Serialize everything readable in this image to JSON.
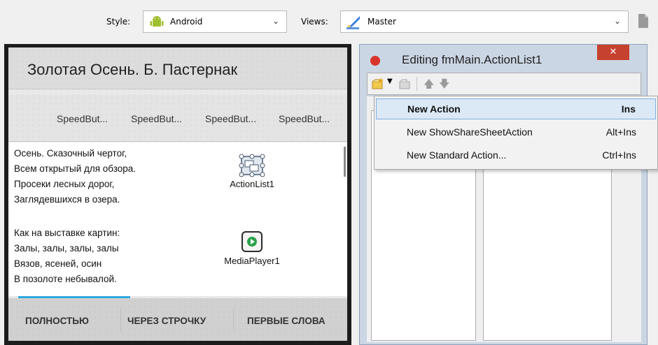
{
  "toolbar": {
    "style_label": "Style:",
    "style_value": "Android",
    "views_label": "Views:",
    "views_value": "Master",
    "style_icon": "android-icon",
    "views_icon": "pencil-ruler-icon"
  },
  "form": {
    "title": "Золотая Осень. Б. Пастернак",
    "speed_buttons": [
      "SpeedBut...",
      "SpeedBut...",
      "SpeedBut...",
      "SpeedBut..."
    ],
    "poem_stanza1": [
      "Осень. Сказочный чертог,",
      "Всем открытый для обзора.",
      "Просеки лесных дорог,",
      "Заглядевшихся в озера."
    ],
    "poem_stanza2": [
      "Как на выставке картин:",
      "Залы, залы, залы, залы",
      "Вязов, ясеней, осин",
      "В позолоте небывалой."
    ],
    "components": [
      {
        "name": "ActionList1",
        "icon": "action-list-icon"
      },
      {
        "name": "MediaPlayer1",
        "icon": "media-player-icon"
      }
    ],
    "tabs": [
      "ПОЛНОСТЬЮ",
      "ЧЕРЕЗ СТРОЧКУ",
      "ПЕРВЫЕ СЛОВА"
    ],
    "accent_color": "#2fa7dd"
  },
  "editor": {
    "title": "Editing fmMain.ActionList1",
    "close_label": "✕",
    "toolbar_buttons": [
      "new-action-icon",
      "dropdown-arrow-icon",
      "delete-icon",
      "move-up-icon",
      "move-down-icon"
    ]
  },
  "menu": {
    "items": [
      {
        "label": "New Action",
        "shortcut": "Ins",
        "selected": true
      },
      {
        "label": "New ShowShareSheetAction",
        "shortcut": "Alt+Ins",
        "selected": false
      },
      {
        "label": "New Standard Action...",
        "shortcut": "Ctrl+Ins",
        "selected": false
      }
    ]
  }
}
